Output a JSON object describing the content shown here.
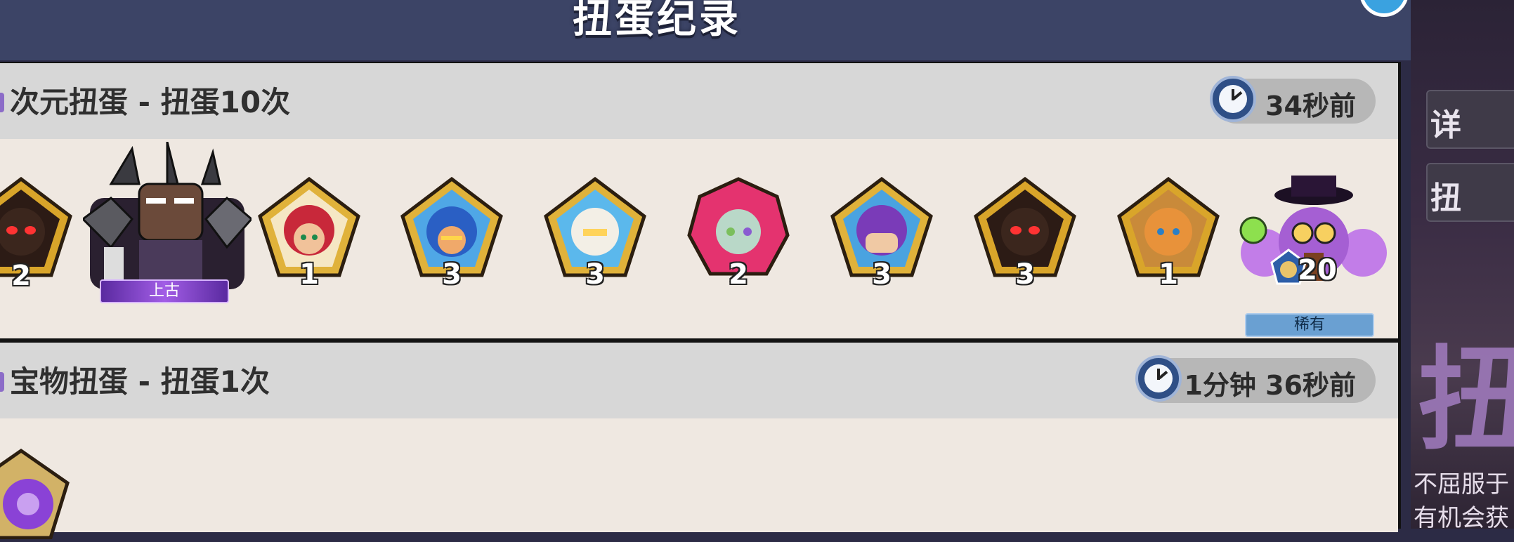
{
  "header": {
    "title": "扭蛋纪录"
  },
  "records": [
    {
      "name": "次元扭蛋 - 扭蛋10次",
      "time": "34秒前",
      "items": [
        {
          "icon": "shadow-cookie-shard-icon",
          "count": "2"
        },
        {
          "icon": "dark-knight-cookie-icon",
          "grade": "上古"
        },
        {
          "icon": "red-hair-cookie-shard-icon",
          "count": "1"
        },
        {
          "icon": "helmet-cookie-shard-icon",
          "count": "3"
        },
        {
          "icon": "white-cookie-shard-icon",
          "count": "3"
        },
        {
          "icon": "pink-gem-cookie-shard-icon",
          "count": "2"
        },
        {
          "icon": "purple-hair-cookie-shard-icon",
          "count": "3"
        },
        {
          "icon": "shadow-cookie-shard-icon",
          "count": "3"
        },
        {
          "icon": "orange-cookie-shard-icon",
          "count": "1"
        },
        {
          "icon": "alchemist-cookie-icon",
          "count": "20",
          "grade": "稀有"
        }
      ]
    },
    {
      "name": "宝物扭蛋 - 扭蛋1次",
      "time": "1分钟 36秒前",
      "items": [
        {
          "icon": "purple-treasure-icon"
        }
      ]
    }
  ],
  "sidebar_bg": {
    "card1_text": "详",
    "card2_text": "扭",
    "big_text": "扭",
    "small_line1": "不屈服于",
    "small_line2": "有机会获"
  },
  "colors": {
    "header": "#3c4466",
    "row_header": "#d7d7d7",
    "row_body": "#efe8e1",
    "clock": "#2f4f86"
  }
}
